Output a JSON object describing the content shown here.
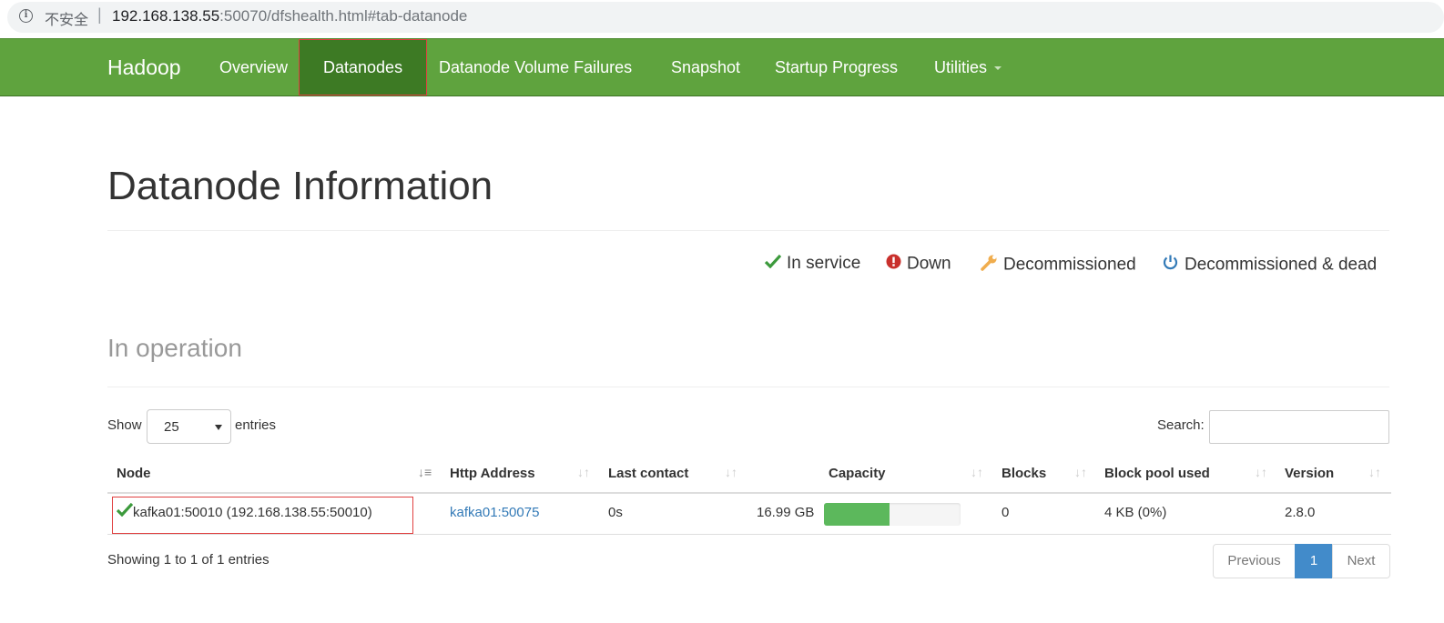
{
  "browser": {
    "security_label": "不安全",
    "separator": "|",
    "url_host": "192.168.138.55",
    "url_rest": ":50070/dfshealth.html#tab-datanode"
  },
  "navbar": {
    "brand": "Hadoop",
    "items": [
      {
        "label": "Overview"
      },
      {
        "label": "Datanodes",
        "active": true
      },
      {
        "label": "Datanode Volume Failures"
      },
      {
        "label": "Snapshot"
      },
      {
        "label": "Startup Progress"
      },
      {
        "label": "Utilities",
        "has_dropdown": true
      }
    ],
    "colors": {
      "bar": "#5fa33e",
      "active": "#3d7a24",
      "highlight_outline": "#e04040"
    }
  },
  "page": {
    "title": "Datanode Information"
  },
  "legend": [
    {
      "icon": "checkmark-icon",
      "label": "In service",
      "color": "#3c9a3c"
    },
    {
      "icon": "exclamation-circle-icon",
      "label": "Down",
      "color": "#c9302c"
    },
    {
      "icon": "wrench-icon",
      "label": "Decommissioned",
      "color": "#f0ad4e"
    },
    {
      "icon": "power-icon",
      "label": "Decommissioned & dead",
      "color": "#337ab7"
    }
  ],
  "in_operation": {
    "title": "In operation",
    "length_menu": {
      "show_label": "Show",
      "selected": "25",
      "entries_label": "entries"
    },
    "search": {
      "label": "Search:",
      "value": ""
    },
    "columns": [
      "Node",
      "Http Address",
      "Last contact",
      "Capacity",
      "Blocks",
      "Block pool used",
      "Version"
    ],
    "sorted_column": "Node",
    "rows": [
      {
        "status_icon": "checkmark-icon",
        "node": "kafka01:50010 (192.168.138.55:50010)",
        "http_address": "kafka01:50075",
        "last_contact": "0s",
        "capacity": "16.99 GB",
        "capacity_used_fraction": 0.48,
        "blocks": "0",
        "block_pool_used": "4 KB (0%)",
        "version": "2.8.0"
      }
    ],
    "info": "Showing 1 to 1 of 1 entries",
    "pagination": {
      "previous": "Previous",
      "current": "1",
      "next": "Next"
    }
  }
}
